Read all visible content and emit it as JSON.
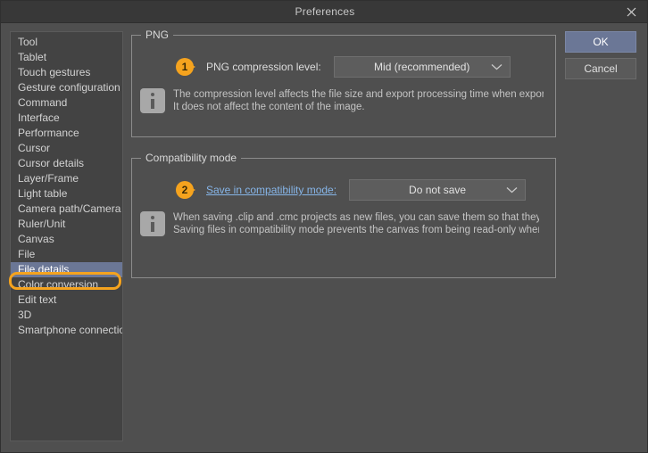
{
  "window": {
    "title": "Preferences",
    "close_icon": "close-icon"
  },
  "sidebar": {
    "items": [
      {
        "label": "Tool",
        "selected": false
      },
      {
        "label": "Tablet",
        "selected": false
      },
      {
        "label": "Touch gestures",
        "selected": false
      },
      {
        "label": "Gesture configuration",
        "selected": false
      },
      {
        "label": "Command",
        "selected": false
      },
      {
        "label": "Interface",
        "selected": false
      },
      {
        "label": "Performance",
        "selected": false
      },
      {
        "label": "Cursor",
        "selected": false
      },
      {
        "label": "Cursor details",
        "selected": false
      },
      {
        "label": "Layer/Frame",
        "selected": false
      },
      {
        "label": "Light table",
        "selected": false
      },
      {
        "label": "Camera path/Camera",
        "selected": false
      },
      {
        "label": "Ruler/Unit",
        "selected": false
      },
      {
        "label": "Canvas",
        "selected": false
      },
      {
        "label": "File",
        "selected": false
      },
      {
        "label": "File details",
        "selected": true
      },
      {
        "label": "Color conversion",
        "selected": false
      },
      {
        "label": "Edit text",
        "selected": false
      },
      {
        "label": "3D",
        "selected": false
      },
      {
        "label": "Smartphone connection",
        "selected": false
      }
    ]
  },
  "groups": {
    "png": {
      "title": "PNG",
      "badge": "1",
      "field_label": "PNG compression level:",
      "combo_value": "Mid (recommended)",
      "combo_arrow_icon": "chevron-down-icon",
      "info_icon": "info-icon",
      "info_line1": "The compression level affects the file size and export processing time when exporting a PNG file.",
      "info_line2": "It does not affect the content of the image."
    },
    "compatibility": {
      "title": "Compatibility mode",
      "badge": "2",
      "field_label": "Save in compatibility mode:",
      "combo_value": "Do not save",
      "combo_arrow_icon": "chevron-down-icon",
      "info_icon": "info-icon",
      "info_line1": "When saving .clip and .cmc projects as new files, you can save them so that they have better compatibility bet",
      "info_line2": "Saving files in compatibility mode prevents the canvas from being read-only when opened in later versions, bu"
    }
  },
  "buttons": {
    "ok": "OK",
    "cancel": "Cancel"
  },
  "colors": {
    "accent_orange": "#f5a31e",
    "selection_blue": "#6b7796",
    "link_blue": "#86b5e8",
    "dialog_bg": "#4f4f4f",
    "titlebar_bg": "#383838"
  }
}
